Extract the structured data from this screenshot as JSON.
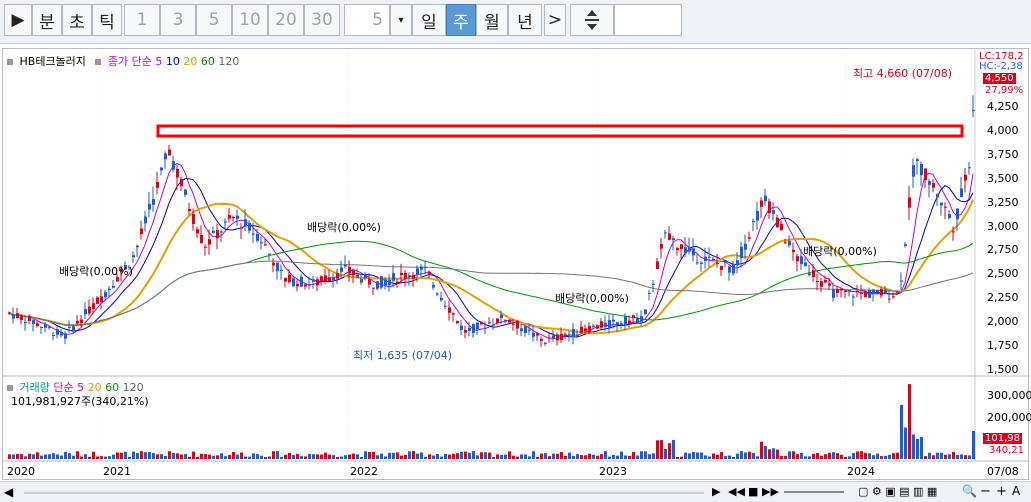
{
  "toolbar": {
    "play_icon": "play-icon",
    "btn_minute": "분",
    "btn_tick_second": "초",
    "btn_tick": "틱",
    "periods": [
      "1",
      "3",
      "5",
      "10",
      "20",
      "30"
    ],
    "period_value": "5",
    "dropdown_icon": "caret-down-icon",
    "btn_day": "일",
    "btn_week": "주",
    "btn_month": "월",
    "btn_year": "년",
    "next_icon": "chevron-right-icon",
    "adjust_icon": "vertical-adjust-icon"
  },
  "price_panel": {
    "stock_name": "HB테크놀러지",
    "ma_title": "종가 단순",
    "ma_periods": [
      "5",
      "10",
      "20",
      "60",
      "120"
    ],
    "ma_colors": [
      "#cc00cc",
      "#0000cc",
      "#e6a000",
      "#009900",
      "#666666"
    ],
    "top_right_lc": "LC:178,2",
    "top_right_hc": "HC:-2,38",
    "high_label": "최고 4,660 (07/08)",
    "low_label": "최저 1,635 (07/04)",
    "current_price": "4,550",
    "change_pct": "27,99%",
    "y_ticks": [
      "4,250",
      "4,000",
      "3,750",
      "3,500",
      "3,250",
      "3,000",
      "2,750",
      "2,500",
      "2,250",
      "2,000",
      "1,750",
      "1,500"
    ],
    "dividend_labels": [
      "배당락(0,00%)",
      "배당락(0,00%)",
      "배당락(0,00%)",
      "배당락(0,00%)"
    ]
  },
  "volume_panel": {
    "title": "거래량",
    "ma_title": "단순",
    "ma_periods": [
      "5",
      "20",
      "60",
      "120"
    ],
    "current_volume": "101,981,927주(340,21%)",
    "y_ticks": [
      "300,000",
      "200,000"
    ],
    "volume_box": "101,98",
    "volume_pct": "340,21"
  },
  "x_axis": {
    "labels": [
      "2020",
      "2021",
      "2022",
      "2023",
      "2024"
    ],
    "last_label": "07/08"
  },
  "bottom_controls": [
    "scroll-left-icon",
    "scroll-right-icon",
    "play-back-icon",
    "stop-icon",
    "play-forward-icon",
    "zoom-icon",
    "minus-icon",
    "plus-icon",
    "font-size-icon"
  ],
  "chart_data": {
    "type": "candlestick",
    "y_range": [
      1500,
      4660
    ],
    "high": 4660,
    "low": 1635,
    "last_close": 4550
  },
  "colors": {
    "up": "#e0001b",
    "down": "#1a5fd1",
    "highlight_box": "#ff0000",
    "active_tab": "#5b9bd5"
  }
}
